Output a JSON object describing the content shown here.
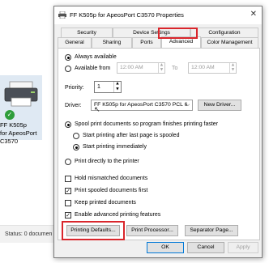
{
  "background": {
    "printer_name_line1": "FF K505p",
    "printer_name_line2": "for ApeosPort C3570",
    "status_label": "Status:",
    "status_value": "0 documen"
  },
  "dialog": {
    "title": "FF K505p for ApeosPort C3570 Properties",
    "tabs_row1": [
      "Security",
      "Device Settings",
      "Configuration"
    ],
    "tabs_row2": [
      "General",
      "Sharing",
      "Ports",
      "Advanced",
      "Color Management"
    ],
    "active_tab": "Advanced"
  },
  "availability": {
    "always_label": "Always available",
    "from_label": "Available from",
    "to_label": "To",
    "from_time": "12:00 AM",
    "to_time": "12:00 AM",
    "selected": "always"
  },
  "priority": {
    "label": "Priority:",
    "value": "1"
  },
  "driver": {
    "label": "Driver:",
    "value": "FF K505p for ApeosPort C3570 PCL 6",
    "new_driver_button": "New Driver..."
  },
  "spooling": {
    "spool_label": "Spool print documents so program finishes printing faster",
    "after_last_page_label": "Start printing after last page is spooled",
    "immediately_label": "Start printing immediately",
    "direct_label": "Print directly to the printer"
  },
  "options": {
    "hold_mismatched": "Hold mismatched documents",
    "print_spooled_first": "Print spooled documents first",
    "keep_printed": "Keep printed documents",
    "enable_advanced": "Enable advanced printing features",
    "hold_mismatched_checked": false,
    "print_spooled_first_checked": true,
    "keep_printed_checked": false,
    "enable_advanced_checked": true
  },
  "buttons": {
    "printing_defaults": "Printing Defaults...",
    "print_processor": "Print Processor...",
    "separator_page": "Separator Page...",
    "ok": "OK",
    "cancel": "Cancel",
    "apply": "Apply"
  },
  "colors": {
    "highlight": "#d9262c",
    "accent": "#0078d7"
  }
}
